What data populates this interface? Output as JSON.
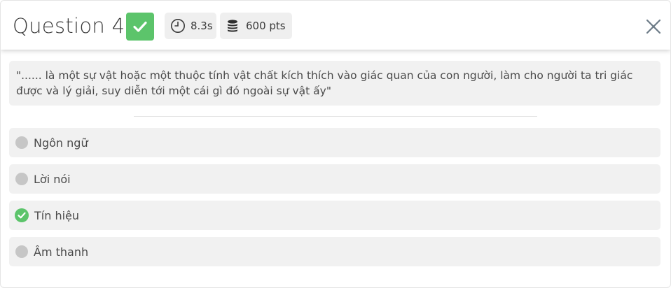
{
  "header": {
    "title": "Question 4",
    "status": "correct",
    "time": "8.3s",
    "points": "600 pts"
  },
  "question": {
    "text": "\"...... là một sự vật hoặc một thuộc tính vật chất kích thích vào giác quan của con người, làm cho người ta tri giác được và lý giải, suy diễn tới một cái gì đó ngoài sự vật ấy\""
  },
  "options": [
    {
      "label": "Ngôn ngữ",
      "correct": false
    },
    {
      "label": "Lời nói",
      "correct": false
    },
    {
      "label": "Tín hiệu",
      "correct": true
    },
    {
      "label": "Âm thanh",
      "correct": false
    }
  ],
  "colors": {
    "accent_green": "#5cc46b",
    "option_bg": "#f1f1f1",
    "neutral_dot": "#c6c6c6",
    "text": "#4a4a4a"
  },
  "icons": {
    "status": "checkmark-icon",
    "time": "clock-icon",
    "points": "coins-icon",
    "close": "close-icon"
  }
}
